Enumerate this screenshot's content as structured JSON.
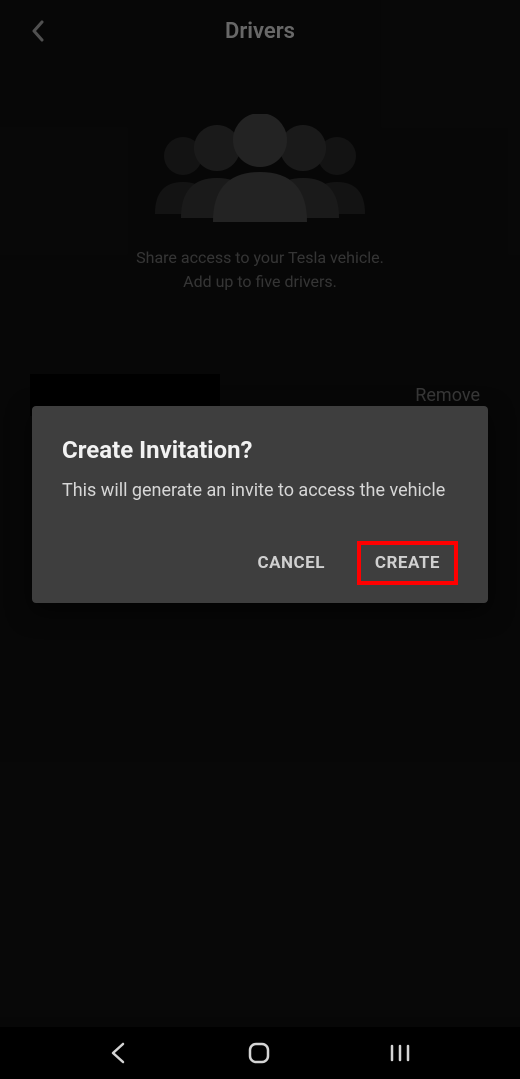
{
  "header": {
    "title": "Drivers"
  },
  "main": {
    "description_line1": "Share access to your Tesla vehicle.",
    "description_line2": "Add up to five drivers."
  },
  "driver_row": {
    "remove_label": "Remove"
  },
  "dialog": {
    "title": "Create Invitation?",
    "body": "This will generate an invite to access the vehicle",
    "cancel_label": "CANCEL",
    "create_label": "CREATE"
  }
}
